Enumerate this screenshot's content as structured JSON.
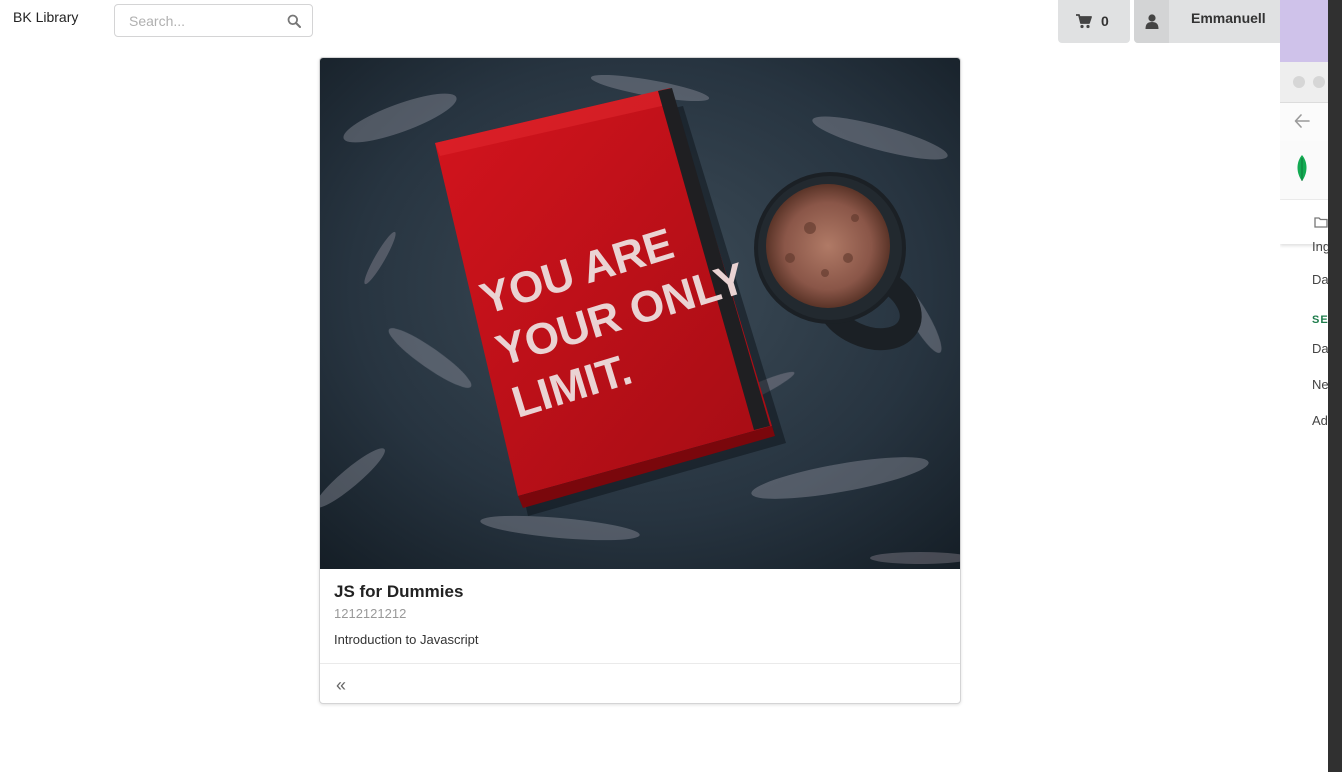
{
  "navbar": {
    "brand": "BK Library",
    "search_placeholder": "Search...",
    "cart_count": "0",
    "user_name": "Emmanuell"
  },
  "book": {
    "title": "JS for Dummies",
    "isbn": "1212121212",
    "description": "Introduction to Javascript",
    "cover_text": [
      "YOU ARE",
      "YOUR ONLY",
      "LIMIT."
    ],
    "back_symbol": "«"
  },
  "side_window": {
    "items": [
      "Ing",
      "Da",
      "SE",
      "Da",
      "Ne",
      "Ad"
    ]
  },
  "colors": {
    "button_bg": "#e0e1e2",
    "notebook_red": "#c8111a",
    "section_green": "#1e7c4b",
    "leaf_green": "#13aa52"
  }
}
